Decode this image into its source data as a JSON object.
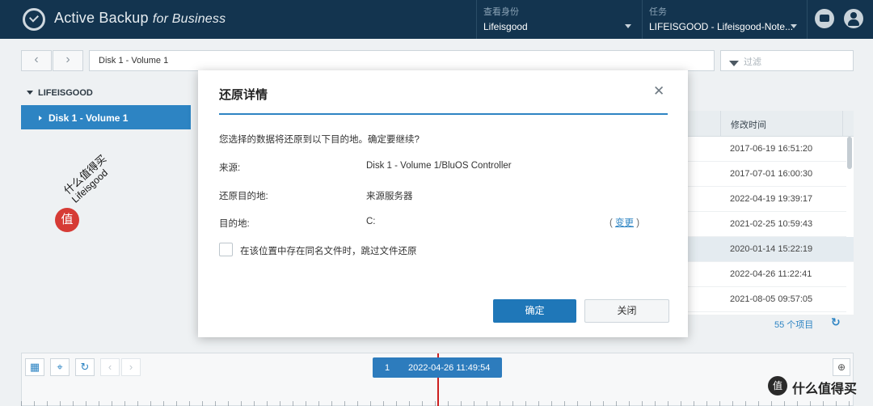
{
  "header": {
    "app_title": "Active Backup",
    "app_title_suffix": "for Business",
    "identity_label": "查看身份",
    "identity_value": "Lifeisgood",
    "task_label": "任务",
    "task_value": "LIFEISGOOD - Lifeisgood-Note..."
  },
  "toolbar": {
    "back_glyph": "‹",
    "forward_glyph": "›",
    "path": "Disk 1 - Volume 1",
    "filter_placeholder": "过滤"
  },
  "tree": {
    "root_label": "LIFEISGOOD",
    "selected_label": "Disk 1 - Volume 1"
  },
  "watermark": {
    "circle_char": "值",
    "line1": "什么值得买",
    "line2": "Lifeisgood"
  },
  "table": {
    "column_header": "修改时间",
    "rows": [
      "2017-06-19 16:51:20",
      "2017-07-01 16:00:30",
      "2022-04-19 19:39:17",
      "2021-02-25 10:59:43",
      "2020-01-14 15:22:19",
      "2022-04-26 11:22:41",
      "2021-08-05 09:57:05"
    ],
    "highlighted_row": 4,
    "item_count": "55 个项目"
  },
  "timeline": {
    "marker_number": "1",
    "marker_time": "2022-04-26 11:49:54"
  },
  "brand": {
    "circle_char": "值",
    "text": "什么值得买"
  },
  "modal": {
    "title": "还原详情",
    "message": "您选择的数据将还原到以下目的地。确定要继续?",
    "source_label": "来源:",
    "source_value": "Disk 1 - Volume 1/BluOS Controller",
    "restore_dest_label": "还原目的地:",
    "restore_dest_value": "来源服务器",
    "dest_label": "目的地:",
    "dest_value": "C:",
    "change_open": "(",
    "change_link": "变更",
    "change_close": ")",
    "skip_checkbox_label": "在该位置中存在同名文件时，跳过文件还原",
    "confirm_button": "确定",
    "close_button": "关闭"
  },
  "colors": {
    "header_bg": "#13344f",
    "accent": "#2d84c3",
    "primary_button": "#1f77b8",
    "timeline_marker": "#cc1f1f"
  }
}
